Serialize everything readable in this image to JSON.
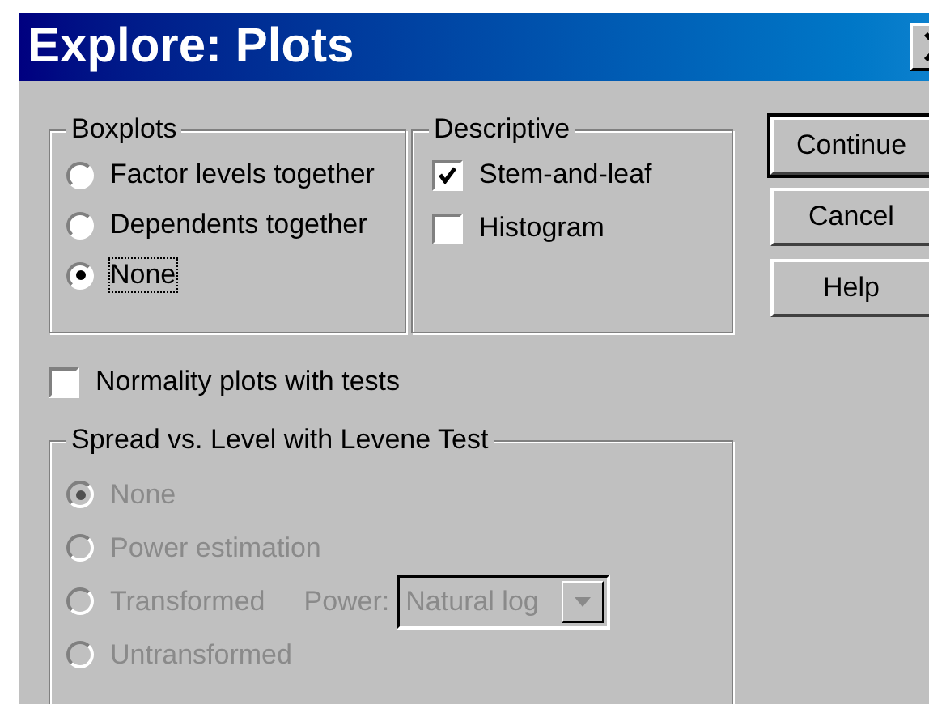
{
  "window": {
    "title": "Explore: Plots"
  },
  "boxplots": {
    "title": "Boxplots",
    "options": [
      {
        "label": "Factor levels together",
        "selected": false,
        "focused": false
      },
      {
        "label": "Dependents together",
        "selected": false,
        "focused": false
      },
      {
        "label": "None",
        "selected": true,
        "focused": true
      }
    ]
  },
  "descriptive": {
    "title": "Descriptive",
    "options": [
      {
        "label": "Stem-and-leaf",
        "checked": true
      },
      {
        "label": "Histogram",
        "checked": false
      }
    ]
  },
  "buttons": [
    {
      "label": "Continue",
      "default": true
    },
    {
      "label": "Cancel",
      "default": false
    },
    {
      "label": "Help",
      "default": false
    }
  ],
  "normality": {
    "label": "Normality plots with tests",
    "checked": false
  },
  "spread": {
    "title": "Spread vs. Level with Levene Test",
    "disabled": true,
    "options": [
      {
        "label": "None",
        "selected": true
      },
      {
        "label": "Power estimation",
        "selected": false
      },
      {
        "label": "Transformed",
        "selected": false,
        "power": {
          "label": "Power:",
          "value": "Natural log"
        }
      },
      {
        "label": "Untransformed",
        "selected": false
      }
    ]
  }
}
